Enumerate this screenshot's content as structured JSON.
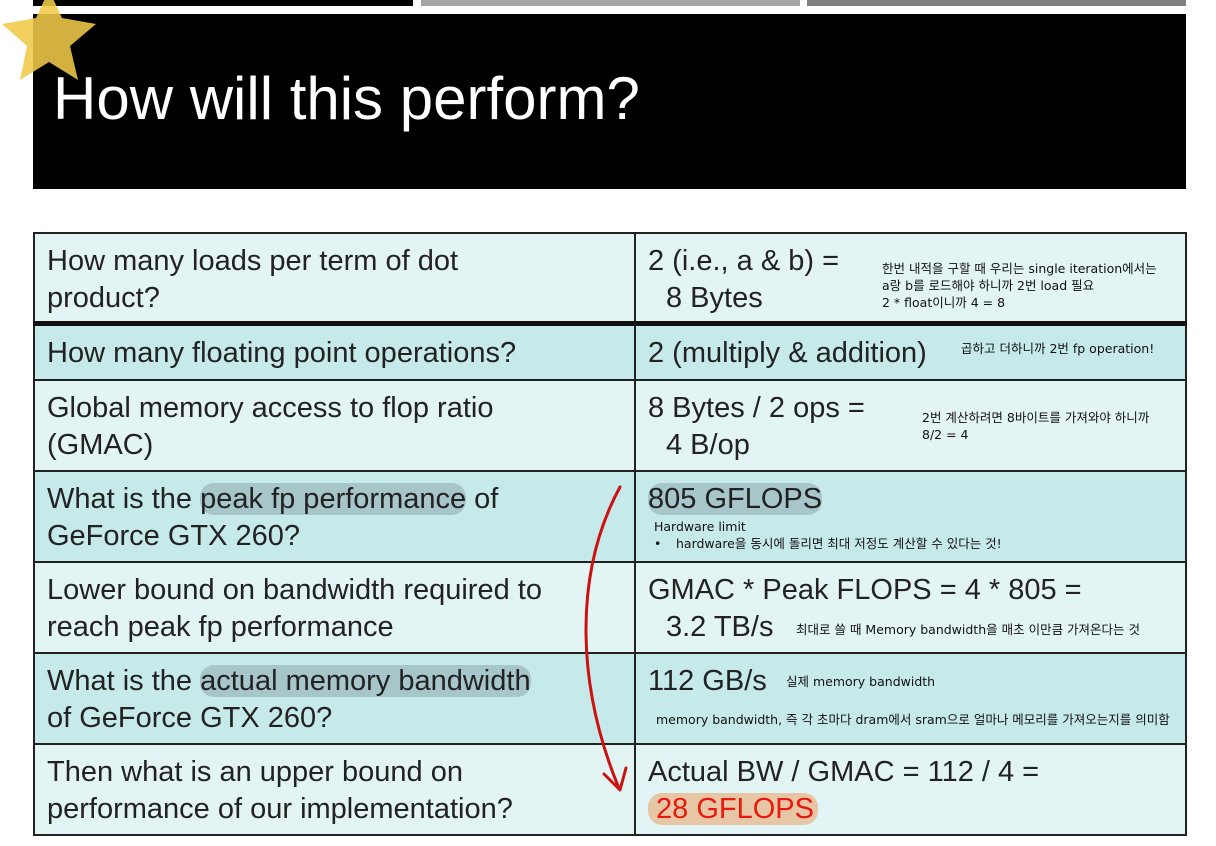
{
  "slide": {
    "title": "How will this perform?"
  },
  "rows": [
    {
      "question_lines": [
        "How many loads per term of dot",
        "product?"
      ],
      "answer_lines": [
        "2 (i.e., a & b) =",
        "8 Bytes"
      ],
      "note_lines": [
        "한번 내적을 구할 때 우리는 single iteration에서는",
        "a랑 b를 로드해야 하니까 2번 load 필요",
        "2 * float이니까 4 = 8"
      ]
    },
    {
      "question_lines": [
        "How many floating point operations?"
      ],
      "answer_lines": [
        "2 (multiply & addition)"
      ],
      "note_lines": [
        "곱하고 더하니까 2번 fp operation!"
      ]
    },
    {
      "question_lines": [
        "Global memory access to flop ratio",
        "(GMAC)"
      ],
      "answer_lines": [
        "8 Bytes / 2 ops =",
        "4 B/op"
      ],
      "note_lines": [
        "2번 계산하려면 8바이트를 가져와야 하니까",
        "8/2 = 4"
      ]
    },
    {
      "question_parts": [
        "What is the ",
        "peak fp performance",
        " of"
      ],
      "question_line2": "GeForce GTX 260?",
      "answer_lines": [
        "805 GFLOPS"
      ],
      "note_title": "Hardware limit",
      "note_bullet": "hardware을 동시에 돌리면 최대 저정도 계산할 수 있다는 것!"
    },
    {
      "question_lines": [
        "Lower bound on bandwidth required to",
        "reach peak fp performance"
      ],
      "answer_lines": [
        "GMAC * Peak FLOPS = 4 * 805 =",
        "3.2 TB/s"
      ],
      "note_lines": [
        "최대로 쓸 때 Memory bandwidth을 매초 이만큼 가져온다는 것"
      ]
    },
    {
      "question_parts": [
        "What is the ",
        "actual memory bandwidth"
      ],
      "question_line2": "of GeForce GTX 260?",
      "answer_lines": [
        "112 GB/s"
      ],
      "note_lines": [
        "실제 memory bandwidth",
        "memory bandwidth, 즉 각 초마다 dram에서 sram으로 얼마나 메모리를 가져오는지를 의미함"
      ]
    },
    {
      "question_lines": [
        "Then what is an upper bound on",
        "performance of our implementation?"
      ],
      "answer_lines": [
        "Actual BW / GMAC = 112 / 4 =",
        "28 GFLOPS"
      ]
    }
  ],
  "colors": {
    "row_light": "#e3f4f4",
    "row_dark": "#c6e9ea",
    "arrow": "#cc1111",
    "result": "#e8190e",
    "star": "#f0c94a"
  },
  "icons": [
    "star-icon",
    "curved-arrow"
  ]
}
